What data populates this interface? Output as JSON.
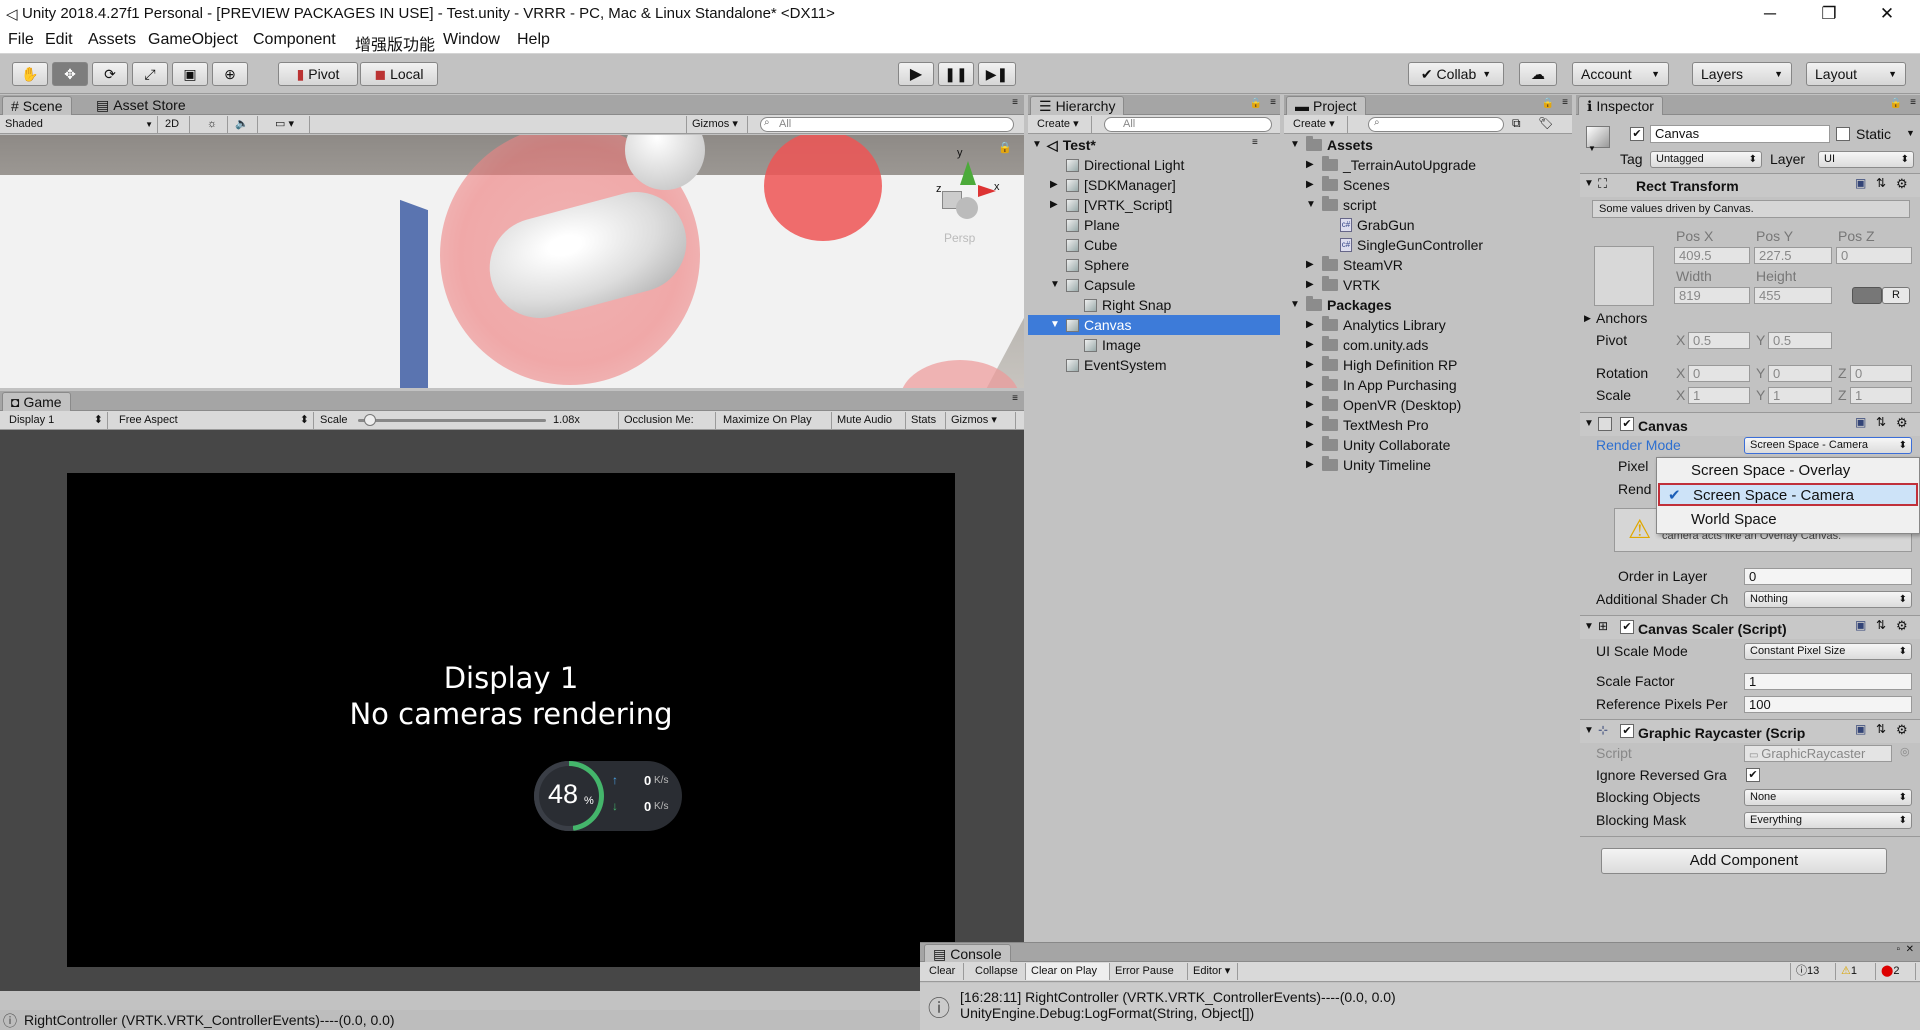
{
  "window": {
    "title": "Unity 2018.4.27f1 Personal - [PREVIEW PACKAGES IN USE] - Test.unity - VRRR - PC, Mac & Linux Standalone* <DX11>"
  },
  "menu": [
    "File",
    "Edit",
    "Assets",
    "GameObject",
    "Component",
    "增强版功能",
    "Window",
    "Help"
  ],
  "toolbar": {
    "pivot": "Pivot",
    "local": "Local",
    "collab": "Collab",
    "account": "Account",
    "layers": "Layers",
    "layout": "Layout"
  },
  "scene": {
    "tab": "Scene",
    "tab2": "Asset Store",
    "shaded": "Shaded",
    "mode2d": "2D",
    "gizmos": "Gizmos",
    "search": "All",
    "persp": "Persp"
  },
  "game": {
    "tab": "Game",
    "display": "Display 1",
    "aspect": "Free Aspect",
    "scale_label": "Scale",
    "scale_value": "1.08x",
    "occlusion": "Occlusion Me:",
    "maximize": "Maximize On Play",
    "mute": "Mute Audio",
    "stats": "Stats",
    "gizmos": "Gizmos",
    "msg1": "Display 1",
    "msg2": "No cameras rendering",
    "widget_percent": "48",
    "widget_unit": "%",
    "up_speed": "0",
    "down_speed": "0",
    "speed_unit": "K/s"
  },
  "hierarchy": {
    "tab": "Hierarchy",
    "create": "Create",
    "search": "All",
    "scene": "Test*",
    "items": [
      "Directional Light",
      "[SDKManager]",
      "[VRTK_Script]",
      "Plane",
      "Cube",
      "Sphere",
      "Capsule",
      "Right Snap",
      "Canvas",
      "Image",
      "EventSystem"
    ]
  },
  "project": {
    "tab": "Project",
    "create": "Create",
    "items": [
      "Assets",
      "_TerrainAutoUpgrade",
      "Scenes",
      "script",
      "GrabGun",
      "SingleGunController",
      "SteamVR",
      "VRTK",
      "Packages",
      "Analytics Library",
      "com.unity.ads",
      "High Definition RP",
      "In App Purchasing",
      "OpenVR (Desktop)",
      "TextMesh Pro",
      "Unity Collaborate",
      "Unity Timeline"
    ]
  },
  "inspector": {
    "tab": "Inspector",
    "name": "Canvas",
    "static": "Static",
    "tag_label": "Tag",
    "tag": "Untagged",
    "layer_label": "Layer",
    "layer": "UI",
    "rect": {
      "title": "Rect Transform",
      "note": "Some values driven by Canvas.",
      "posx_label": "Pos X",
      "posy_label": "Pos Y",
      "posz_label": "Pos Z",
      "posx": "409.5",
      "posy": "227.5",
      "posz": "0",
      "width_label": "Width",
      "height_label": "Height",
      "width": "819",
      "height": "455",
      "r": "R",
      "anchors": "Anchors",
      "pivot": "Pivot",
      "pivot_x": "0.5",
      "pivot_y": "0.5",
      "rotation": "Rotation",
      "rot_x": "0",
      "rot_y": "0",
      "rot_z": "0",
      "scale": "Scale",
      "scale_x": "1",
      "scale_y": "1",
      "scale_z": "1",
      "x": "X",
      "y": "Y",
      "z": "Z"
    },
    "canvas": {
      "title": "Canvas",
      "render_mode_label": "Render Mode",
      "render_mode": "Screen Space - Camera",
      "pixel_label": "Pixel",
      "render_label": "Rend",
      "warning": "camera acts like an Overlay Canvas.",
      "order_label": "Order in Layer",
      "order": "0",
      "shader_label": "Additional Shader Ch",
      "shader": "Nothing"
    },
    "dropdown": {
      "options": [
        "Screen Space - Overlay",
        "Screen Space - Camera",
        "World Space"
      ],
      "selected": "Screen Space - Camera"
    },
    "scaler": {
      "title": "Canvas Scaler (Script)",
      "mode_label": "UI Scale Mode",
      "mode": "Constant Pixel Size",
      "factor_label": "Scale Factor",
      "factor": "1",
      "ref_label": "Reference Pixels Per",
      "ref": "100"
    },
    "raycaster": {
      "title": "Graphic Raycaster (Scrip",
      "script_label": "Script",
      "script": "GraphicRaycaster",
      "ignore_label": "Ignore Reversed Gra",
      "blocking_label": "Blocking Objects",
      "blocking": "None",
      "mask_label": "Blocking Mask",
      "mask": "Everything"
    },
    "add_component": "Add Component"
  },
  "console": {
    "tab": "Console",
    "clear": "Clear",
    "collapse": "Collapse",
    "clear_on_play": "Clear on Play",
    "error_pause": "Error Pause",
    "editor": "Editor",
    "info_count": "13",
    "warn_count": "1",
    "error_count": "2",
    "line1": "[16:28:11] RightController (VRTK.VRTK_ControllerEvents)----(0.0, 0.0)",
    "line2": "UnityEngine.Debug:LogFormat(String, Object[])"
  },
  "status": {
    "text": "RightController (VRTK.VRTK_ControllerEvents)----(0.0, 0.0)"
  }
}
